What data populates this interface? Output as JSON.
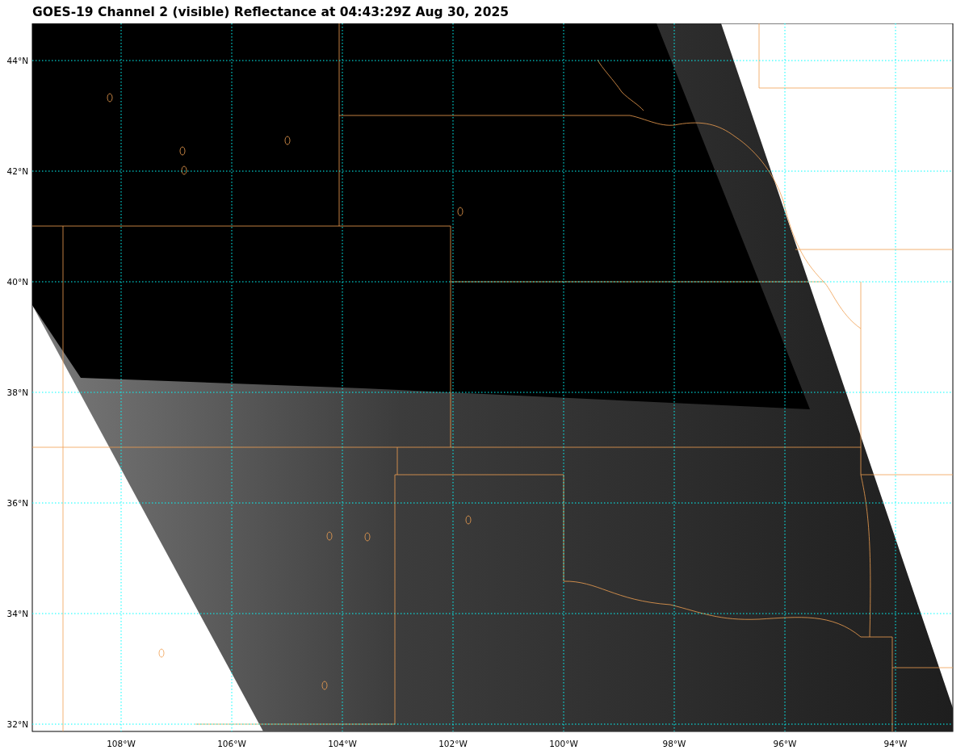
{
  "title": "GOES-19 Channel 2 (visible) Reflectance at 04:43:29Z Aug 30, 2025",
  "map": {
    "lat_labels": [
      "44°N",
      "42°N",
      "40°N",
      "38°N",
      "36°N",
      "34°N",
      "32°N"
    ],
    "lon_labels": [
      "108°W",
      "106°W",
      "104°W",
      "102°W",
      "100°W",
      "98°W",
      "96°W",
      "94°W"
    ]
  }
}
